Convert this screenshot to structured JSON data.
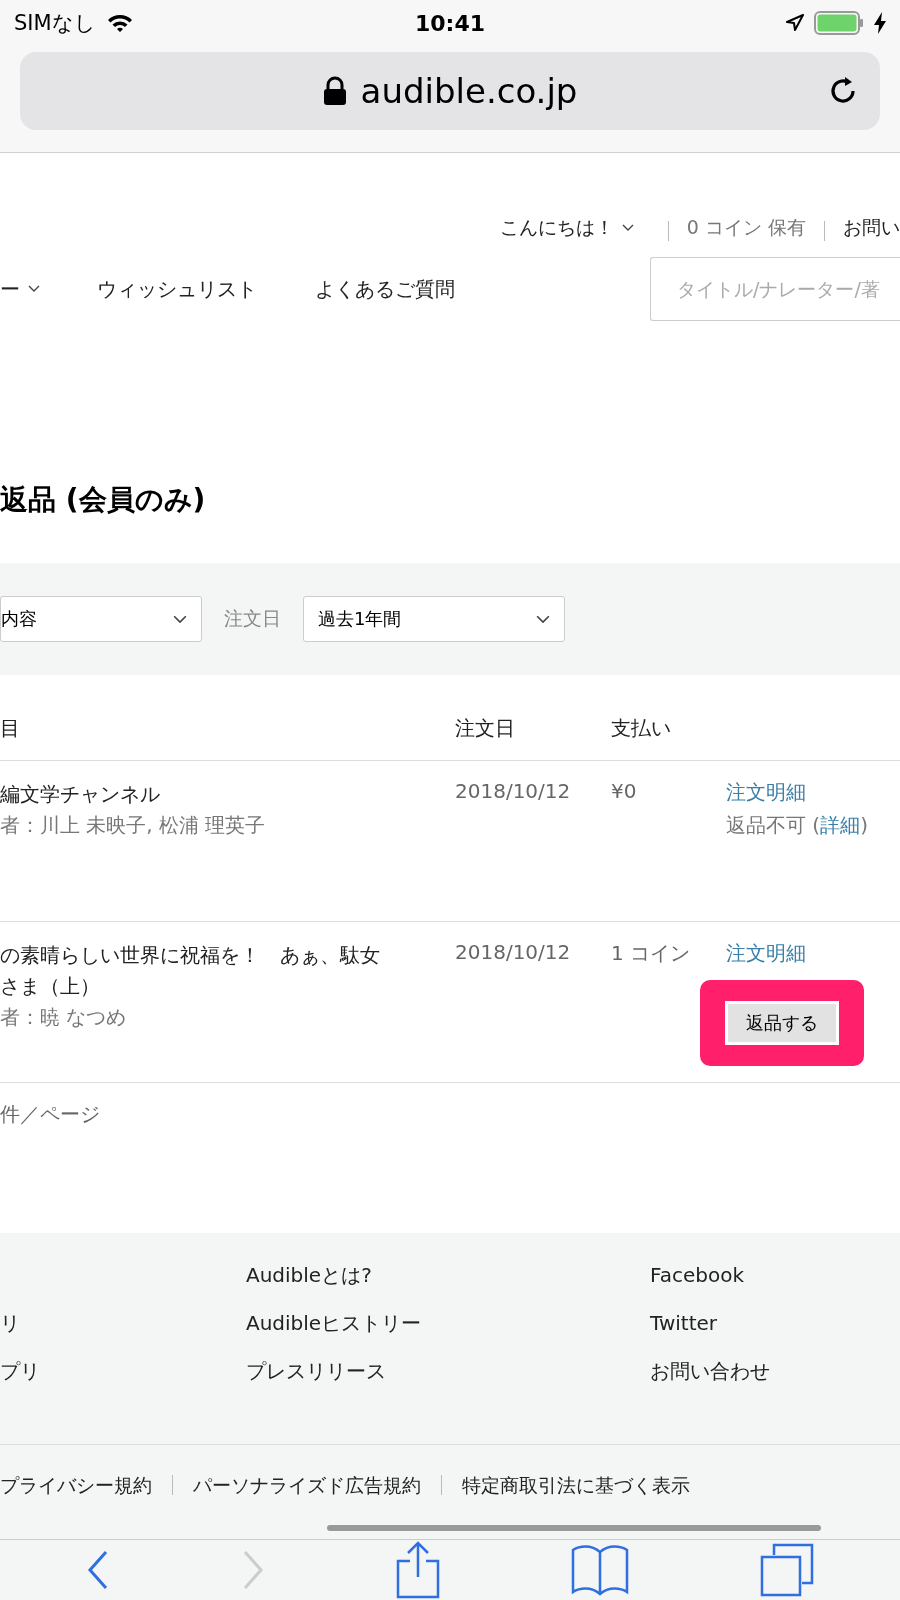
{
  "status_bar": {
    "carrier": "SIMなし",
    "time": "10:41",
    "battery": {
      "level": 1
    }
  },
  "address_bar": {
    "url": "audible.co.jp"
  },
  "account_bar": {
    "greeting": "こんにちは！",
    "coins": "0 コイン 保有",
    "contact": "お問い"
  },
  "nav": {
    "items": [
      {
        "label": "ー",
        "dropdown": true
      },
      {
        "label": "ウィッシュリスト",
        "dropdown": false
      },
      {
        "label": "よくあるご質問",
        "dropdown": false
      }
    ],
    "search": {
      "placeholder": "タイトル/ナレーター/著"
    }
  },
  "page_title": "返品 (会員のみ)",
  "filters": {
    "type_select": {
      "value": "内容"
    },
    "date_label": "注文日",
    "date_select": {
      "value": "過去1年間"
    }
  },
  "table": {
    "columns": [
      "目",
      "注文日",
      "支払い"
    ],
    "rows": [
      {
        "title": "編文学チャンネル",
        "author": "者：川上 未映子, 松浦 理英子",
        "date": "2018/10/12",
        "payment": "¥0",
        "details_link": "注文明細",
        "returnable": false,
        "note_prefix": "返品不可 (",
        "note_link": "詳細",
        "note_suffix": ")"
      },
      {
        "title": "の素晴らしい世界に祝福を！　あぁ、駄女",
        "title_line2": "さま（上）",
        "author": "者：暁 なつめ",
        "date": "2018/10/12",
        "payment": "1 コイン",
        "details_link": "注文明細",
        "returnable": true,
        "return_button": "返品する",
        "highlighted": true
      }
    ]
  },
  "per_page": "件／ページ",
  "footer": {
    "columns": [
      [
        "リ",
        "プリ"
      ],
      [
        "Audibleとは?",
        "Audibleヒストリー",
        "プレスリリース"
      ],
      [
        "Facebook",
        "Twitter",
        "お問い合わせ"
      ]
    ],
    "legal_links": [
      "プライバシー規約",
      "パーソナライズド広告規約",
      "特定商取引法に基づく表示"
    ]
  },
  "toolbar": {
    "back_enabled": true,
    "forward_enabled": false
  }
}
